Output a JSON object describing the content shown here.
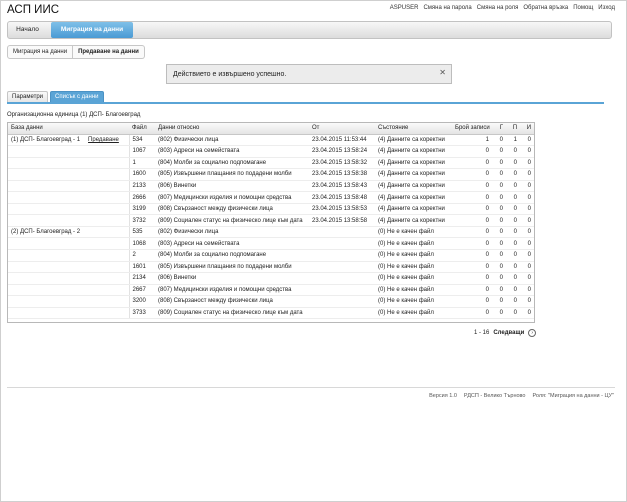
{
  "app": {
    "title": "АСП ИИС"
  },
  "toplinks": [
    "ASPUSER",
    "Смяна на парола",
    "Смяна на роля",
    "Обратна връзка",
    "Помощ",
    "Изход"
  ],
  "nav": {
    "home": "Начало",
    "migration": "Миграция на данни"
  },
  "breadcrumb": {
    "item1": "Миграция на данни",
    "item2": "Предаване на данни"
  },
  "message": {
    "text": "Действието е извършено успешно.",
    "close": "✕"
  },
  "tabs": {
    "params": "Параметри",
    "list": "Списък с данни"
  },
  "org_unit": "Организационна единица (1) ДСП- Благоевград",
  "table": {
    "headers": [
      "База данни",
      "Файл",
      "Данни относно",
      "От",
      "Състояние",
      "Брой записи",
      "Г",
      "П",
      "И"
    ],
    "groups": [
      {
        "db": "(1) ДСП- Благоевград - 1",
        "action": "Предаване",
        "rows": [
          [
            "534",
            "(802) Физически лица",
            "23.04.2015 11:53:44",
            "(4) Данните са коректни",
            "1",
            "0",
            "1",
            "0"
          ],
          [
            "1067",
            "(803) Адреси на семействата",
            "23.04.2015 13:58:24",
            "(4) Данните са коректни",
            "0",
            "0",
            "0",
            "0"
          ],
          [
            "1",
            "(804) Молби за социално подпомагане",
            "23.04.2015 13:58:32",
            "(4) Данните са коректни",
            "0",
            "0",
            "0",
            "0"
          ],
          [
            "1600",
            "(805) Извършени плащания по подадени молби",
            "23.04.2015 13:58:38",
            "(4) Данните са коректни",
            "0",
            "0",
            "0",
            "0"
          ],
          [
            "2133",
            "(806) Винетки",
            "23.04.2015 13:58:43",
            "(4) Данните са коректни",
            "0",
            "0",
            "0",
            "0"
          ],
          [
            "2666",
            "(807) Медицински изделия и помощни средства",
            "23.04.2015 13:58:48",
            "(4) Данните са коректни",
            "0",
            "0",
            "0",
            "0"
          ],
          [
            "3199",
            "(808) Свързаност между физически лица",
            "23.04.2015 13:58:53",
            "(4) Данните са коректни",
            "0",
            "0",
            "0",
            "0"
          ],
          [
            "3732",
            "(809) Социален статус на физическо лице към дата",
            "23.04.2015 13:58:58",
            "(4) Данните са коректни",
            "0",
            "0",
            "0",
            "0"
          ]
        ]
      },
      {
        "db": "(2) ДСП- Благоевград - 2",
        "action": "",
        "rows": [
          [
            "535",
            "(802) Физически лица",
            "",
            "(0) Не е качен файл",
            "0",
            "0",
            "0",
            "0"
          ],
          [
            "1068",
            "(803) Адреси на семействата",
            "",
            "(0) Не е качен файл",
            "0",
            "0",
            "0",
            "0"
          ],
          [
            "2",
            "(804) Молби за социално подпомагане",
            "",
            "(0) Не е качен файл",
            "0",
            "0",
            "0",
            "0"
          ],
          [
            "1601",
            "(805) Извършени плащания по подадени молби",
            "",
            "(0) Не е качен файл",
            "0",
            "0",
            "0",
            "0"
          ],
          [
            "2134",
            "(806) Винетки",
            "",
            "(0) Не е качен файл",
            "0",
            "0",
            "0",
            "0"
          ],
          [
            "2667",
            "(807) Медицински изделия и помощни средства",
            "",
            "(0) Не е качен файл",
            "0",
            "0",
            "0",
            "0"
          ],
          [
            "3200",
            "(808) Свързаност между физически лица",
            "",
            "(0) Не е качен файл",
            "0",
            "0",
            "0",
            "0"
          ],
          [
            "3733",
            "(809) Социален статус на физическо лице към дата",
            "",
            "(0) Не е качен файл",
            "0",
            "0",
            "0",
            "0"
          ]
        ]
      }
    ]
  },
  "pager": {
    "range": "1 - 16",
    "next": "Следващи",
    "next_icon": "›"
  },
  "footer": {
    "version": "Версия 1.0",
    "org": "РДСП - Велико Търново",
    "role": "Роля: \"Миграция на данни - ЦУ\""
  }
}
